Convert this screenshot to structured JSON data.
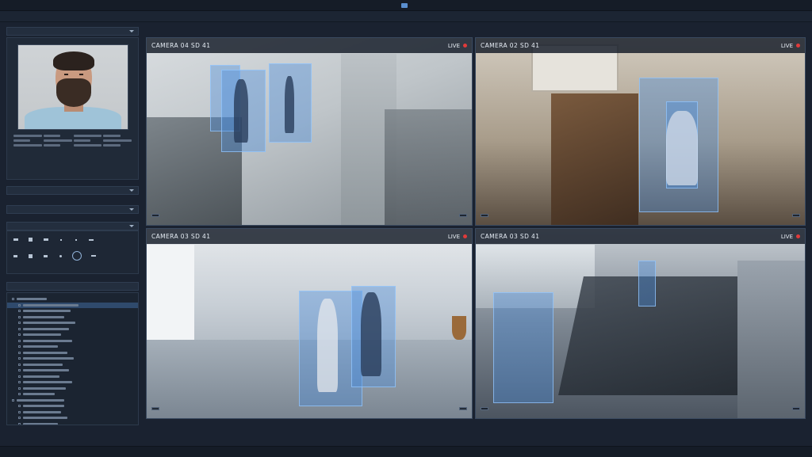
{
  "title": "",
  "menu": [],
  "menu_right": "",
  "sidebar": {
    "profile_title": "",
    "sections": [],
    "camera_list_title": ""
  },
  "main_title": "",
  "cameras": [
    {
      "name": "CAMERA 04 SD 41",
      "status": "LIVE",
      "meta_right": [
        "",
        ""
      ],
      "time_label": "",
      "footer_mid": [
        "",
        ""
      ],
      "resolution": "",
      "timecode": ""
    },
    {
      "name": "CAMERA 02 SD 41",
      "status": "LIVE",
      "meta_right": [
        "",
        ""
      ],
      "time_label": "",
      "footer_mid": [
        "",
        ""
      ],
      "resolution": "",
      "timecode": ""
    },
    {
      "name": "CAMERA 03 SD 41",
      "status": "LIVE",
      "meta_right": [
        "",
        ""
      ],
      "time_label": "",
      "footer_mid": [
        "",
        ""
      ],
      "resolution": "",
      "timecode": ""
    },
    {
      "name": "CAMERA 03 SD 41",
      "status": "LIVE",
      "meta_right": [
        "",
        ""
      ],
      "time_label": "",
      "footer_mid": [
        "",
        ""
      ],
      "resolution": "",
      "timecode": ""
    }
  ],
  "session": "",
  "status_left": "",
  "colors": {
    "accent": "#468cdc",
    "live": "#e03a3a",
    "panel": "#1a2230"
  },
  "icons": [
    "camera-icon",
    "live-dot-icon",
    "caret-icon",
    "play-icon",
    "stop-icon",
    "record-icon"
  ]
}
